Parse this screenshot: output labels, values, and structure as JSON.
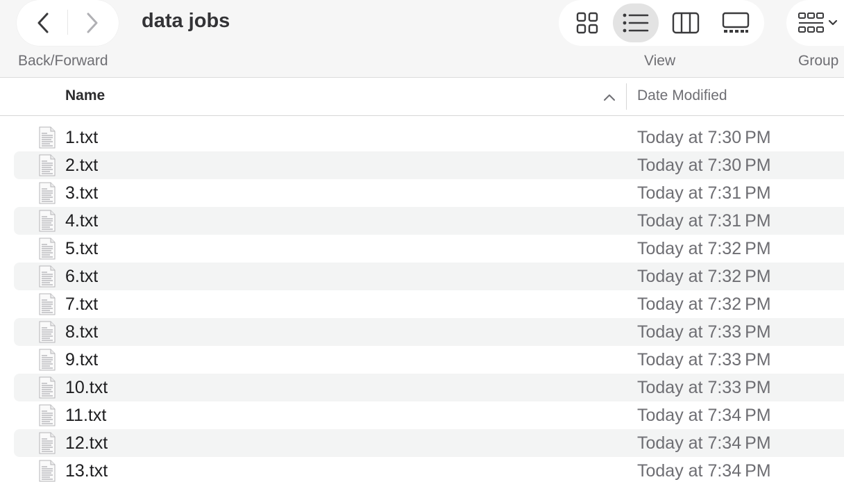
{
  "toolbar": {
    "folder_title": "data jobs",
    "back_forward_caption": "Back/Forward",
    "view_caption": "View",
    "group_caption": "Group",
    "back_icon": "chevron-left-icon",
    "forward_icon": "chevron-right-icon",
    "view_modes": [
      "icons",
      "list",
      "columns",
      "gallery"
    ],
    "selected_view": "list"
  },
  "columns": {
    "name": "Name",
    "date_modified": "Date Modified",
    "sort": "ascending"
  },
  "files": [
    {
      "name": "1.txt",
      "date": "Today at 7:30 PM"
    },
    {
      "name": "2.txt",
      "date": "Today at 7:30 PM"
    },
    {
      "name": "3.txt",
      "date": "Today at 7:31 PM"
    },
    {
      "name": "4.txt",
      "date": "Today at 7:31 PM"
    },
    {
      "name": "5.txt",
      "date": "Today at 7:32 PM"
    },
    {
      "name": "6.txt",
      "date": "Today at 7:32 PM"
    },
    {
      "name": "7.txt",
      "date": "Today at 7:32 PM"
    },
    {
      "name": "8.txt",
      "date": "Today at 7:33 PM"
    },
    {
      "name": "9.txt",
      "date": "Today at 7:33 PM"
    },
    {
      "name": "10.txt",
      "date": "Today at 7:33 PM"
    },
    {
      "name": "11.txt",
      "date": "Today at 7:34 PM"
    },
    {
      "name": "12.txt",
      "date": "Today at 7:34 PM"
    },
    {
      "name": "13.txt",
      "date": "Today at 7:34 PM"
    }
  ],
  "colors": {
    "toolbar_bg": "#f6f6f6",
    "row_alt": "#f3f4f4",
    "selected_view_bg": "#e3e3e3",
    "icon_stroke": "#3a3a3c",
    "secondary_text": "#6e6e73"
  }
}
